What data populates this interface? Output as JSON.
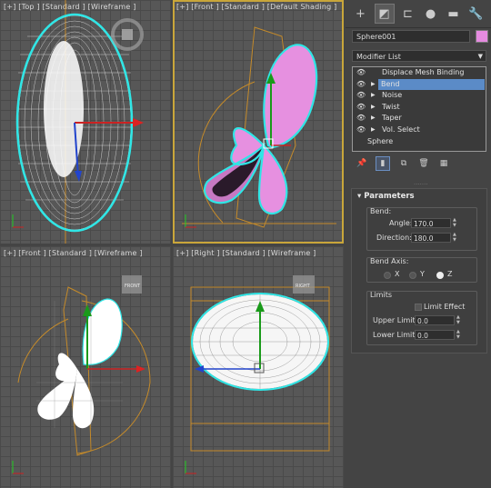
{
  "viewports": {
    "top": {
      "label": "[+] [Top ] [Standard ] [Wireframe ]"
    },
    "front_shaded": {
      "label": "[+] [Front ] [Standard ] [Default Shading ]"
    },
    "front_wire": {
      "label": "[+] [Front ] [Standard ] [Wireframe ]"
    },
    "right": {
      "label": "[+] [Right ] [Standard ] [Wireframe ]"
    },
    "viewcube": {
      "front_face": "FRONT",
      "right_face": "RIGHT"
    }
  },
  "command_panel": {
    "tabs": [
      {
        "name": "create-tab",
        "icon": "+"
      },
      {
        "name": "modify-tab",
        "icon": "◩"
      },
      {
        "name": "hierarchy-tab",
        "icon": "⊏"
      },
      {
        "name": "motion-tab",
        "icon": "●"
      },
      {
        "name": "display-tab",
        "icon": "▬"
      },
      {
        "name": "utilities-tab",
        "icon": "🔧"
      }
    ],
    "object_name": "Sphere001",
    "object_color": "#e58be0",
    "modifier_list": "Modifier List",
    "stack": [
      {
        "label": "Displace Mesh Binding (WSM)",
        "selected": false
      },
      {
        "label": "Bend",
        "selected": true
      },
      {
        "label": "Noise",
        "selected": false
      },
      {
        "label": "Twist",
        "selected": false
      },
      {
        "label": "Taper",
        "selected": false
      },
      {
        "label": "Vol. Select",
        "selected": false
      },
      {
        "label": "Sphere",
        "selected": false
      }
    ],
    "parameters": {
      "title": "Parameters",
      "bend_group": "Bend:",
      "angle_label": "Angle:",
      "angle_value": "170.0",
      "direction_label": "Direction:",
      "direction_value": "180.0",
      "axis_group": "Bend Axis:",
      "axis_x": "X",
      "axis_y": "Y",
      "axis_z": "Z",
      "axis_selected": "Z",
      "limits_group": "Limits",
      "limit_effect": "Limit Effect",
      "upper_label": "Upper Limit:",
      "upper_value": "0.0",
      "lower_label": "Lower Limit:",
      "lower_value": "0.0"
    }
  }
}
